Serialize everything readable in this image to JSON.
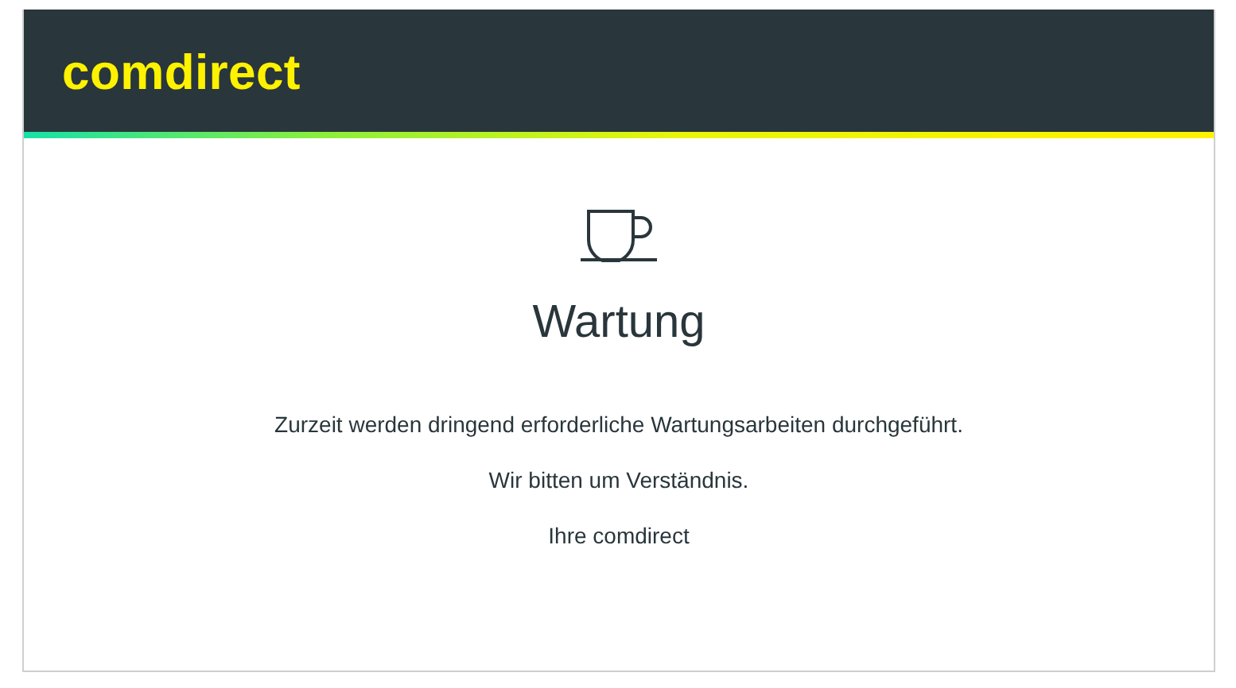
{
  "header": {
    "logo": "comdirect"
  },
  "message": {
    "title": "Wartung",
    "paragraphs": [
      "Zurzeit werden dringend erforderliche Wartungsarbeiten durchgeführt.",
      "Wir bitten um Verständnis.",
      "Ihre comdirect"
    ]
  }
}
